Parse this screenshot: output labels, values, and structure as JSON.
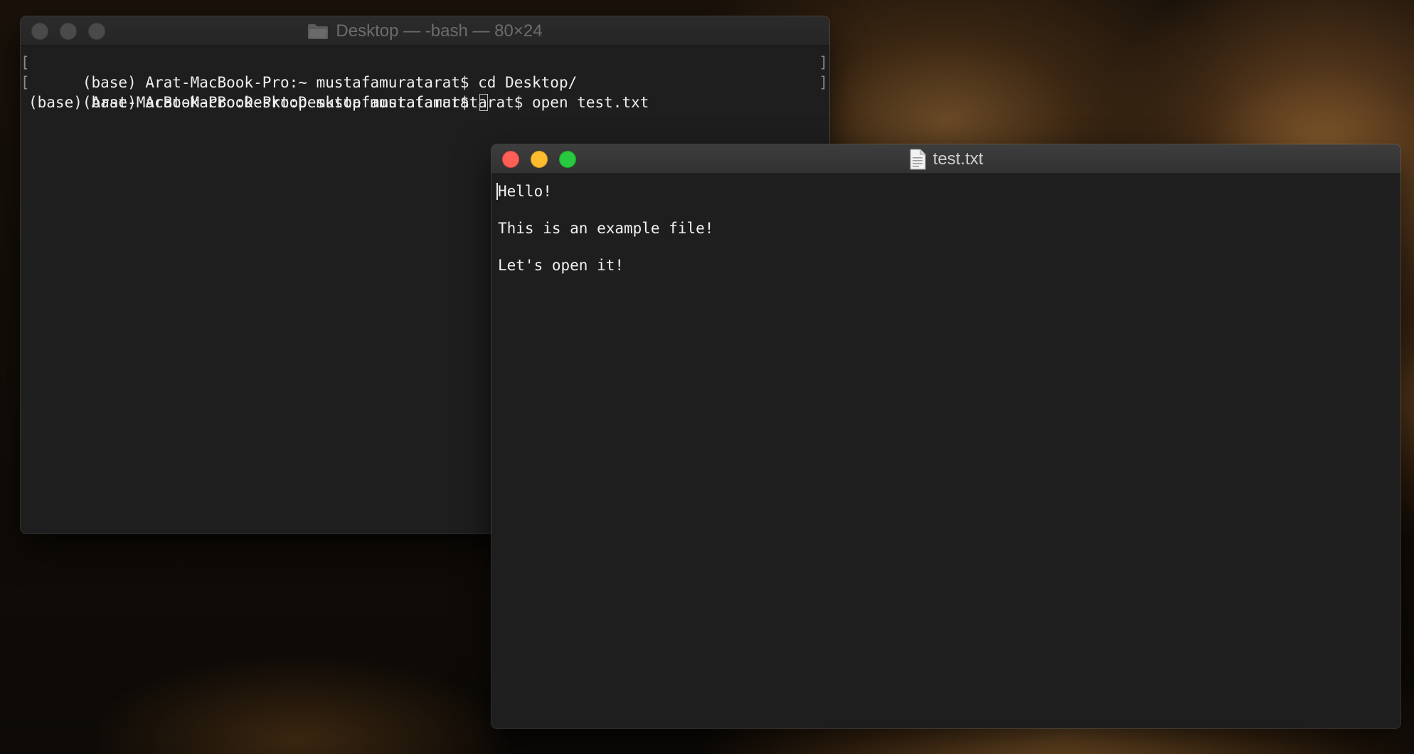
{
  "terminal": {
    "title": "Desktop — -bash — 80×24",
    "title_icon": "folder-icon",
    "lines": [
      {
        "text": "(base) Arat-MacBook-Pro:~ mustafamuratarat$ cd Desktop/",
        "marked": true
      },
      {
        "text": "(base) Arat-MacBook-Pro:Desktop mustafamuratarat$ open test.txt",
        "marked": true
      },
      {
        "text": "(base) Arat-MacBook-Pro:Desktop mustafamuratarat$ ",
        "marked": false
      }
    ],
    "mark_left": "[",
    "mark_right": "]"
  },
  "editor": {
    "title": "test.txt",
    "title_icon": "document-icon",
    "lines": [
      "Hello!",
      "This is an example file!",
      "Let's open it!"
    ]
  },
  "colors": {
    "close": "#fe5f57",
    "minimize": "#febc2e",
    "zoom": "#28c840",
    "window_bg": "#1e1e1e"
  }
}
